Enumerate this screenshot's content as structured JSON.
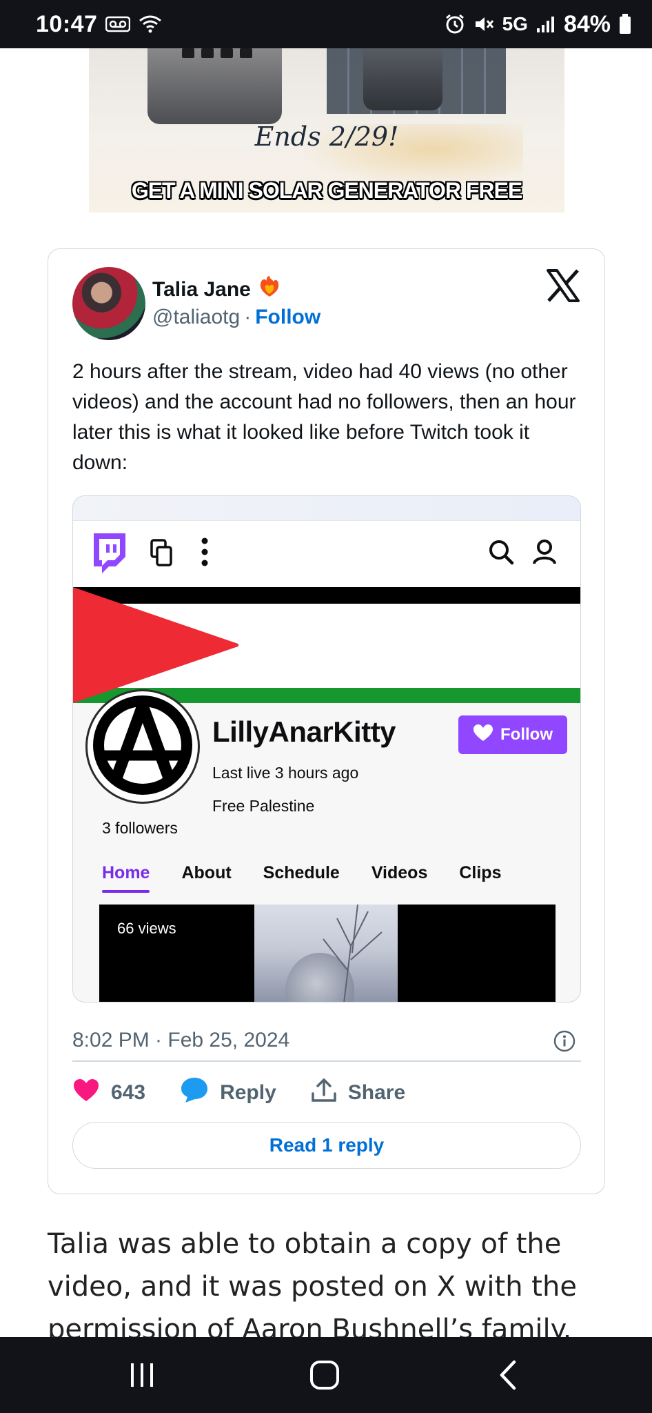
{
  "status_bar": {
    "time": "10:47",
    "network": "5G",
    "battery": "84%"
  },
  "ad": {
    "ends_text": "Ends 2/29!",
    "cta_text": "GET A MINI SOLAR GENERATOR FREE"
  },
  "tweet": {
    "author_name": "Talia Jane",
    "author_handle": "@taliaotg",
    "separator": "·",
    "follow_label": "Follow",
    "text": "2 hours after the stream, video had 40 views (no other videos) and the account had no followers, then an hour later this is what it looked like before Twitch took it down:",
    "timestamp": "8:02 PM · Feb 25, 2024",
    "likes_count": "643",
    "reply_label": "Reply",
    "share_label": "Share",
    "read_replies_label": "Read 1 reply"
  },
  "embedded_screenshot": {
    "channel_name": "LillyAnarKitty",
    "follow_button_label": "Follow",
    "last_live": "Last live 3 hours ago",
    "bio": "Free Palestine",
    "followers": "3 followers",
    "tabs": [
      {
        "label": "Home",
        "active": true
      },
      {
        "label": "About",
        "active": false
      },
      {
        "label": "Schedule",
        "active": false
      },
      {
        "label": "Videos",
        "active": false
      },
      {
        "label": "Clips",
        "active": false
      }
    ],
    "video_views": "66 views",
    "colors": {
      "twitch_purple": "#9147ff",
      "flag_red": "#ee2a35",
      "flag_green": "#17982f"
    }
  },
  "article": {
    "paragraph": "Talia was able to obtain a copy of the video, and it was posted on X with the permission of Aaron Bushnell’s family."
  },
  "icons": [
    "voicemail-icon",
    "wifi-icon",
    "alarm-icon",
    "mute-icon",
    "signal-icon",
    "battery-icon",
    "x-logo-icon",
    "twitch-logo-icon",
    "copy-icon",
    "more-vertical-icon",
    "search-icon",
    "user-icon",
    "anarchy-symbol-icon",
    "heart-icon",
    "reply-bubble-icon",
    "share-icon",
    "info-icon",
    "recents-icon",
    "home-icon",
    "back-icon"
  ]
}
